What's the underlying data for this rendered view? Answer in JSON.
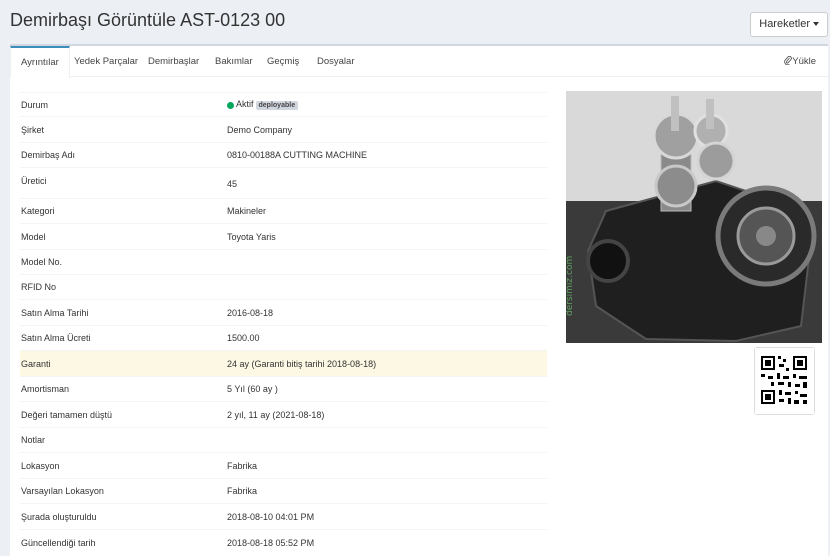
{
  "page": {
    "title": "Demirbaşı Görüntüle AST-0123 00",
    "actions_label": "Hareketler"
  },
  "tabs": [
    {
      "label": "Ayrıntılar"
    },
    {
      "label": "Yedek Parçalar"
    },
    {
      "label": "Demirbaşlar"
    },
    {
      "label": "Bakımlar"
    },
    {
      "label": "Geçmiş"
    },
    {
      "label": "Dosyalar"
    }
  ],
  "upload_label": "Yükle",
  "status": {
    "text": "Aktif",
    "badge": "deployable",
    "color": "#00a65a"
  },
  "rows": [
    {
      "label": "Durum",
      "value": ""
    },
    {
      "label": "Şirket",
      "value": "Demo Company"
    },
    {
      "label": "Demirbaş Adı",
      "value": "0810-00188A CUTTING MACHINE"
    },
    {
      "label": "Üretici",
      "value": "45"
    },
    {
      "label": "Kategori",
      "value": "Makineler"
    },
    {
      "label": "Model",
      "value": "Toyota Yaris"
    },
    {
      "label": "Model No.",
      "value": ""
    },
    {
      "label": "RFID No",
      "value": ""
    },
    {
      "label": "Satın Alma Tarihi",
      "value": "2016-08-18"
    },
    {
      "label": "Satın Alma Ücreti",
      "value": "1500.00"
    },
    {
      "label": "Garanti",
      "value": "24 ay (Garanti bitiş tarihi 2018-08-18)"
    },
    {
      "label": "Amortisman",
      "value": "5 Yıl (60 ay )"
    },
    {
      "label": "Değeri tamamen düştü",
      "value": "2 yıl, 11 ay (2021-08-18)"
    },
    {
      "label": "Notlar",
      "value": ""
    },
    {
      "label": "Lokasyon",
      "value": "Fabrika"
    },
    {
      "label": "Varsayılan Lokasyon",
      "value": "Fabrika"
    },
    {
      "label": "Şurada oluşturuldu",
      "value": "2018-08-10 04:01 PM"
    },
    {
      "label": "Güncellendiği tarih",
      "value": "2018-08-18 05:52 PM"
    }
  ],
  "watermark": "dersimiz.com"
}
